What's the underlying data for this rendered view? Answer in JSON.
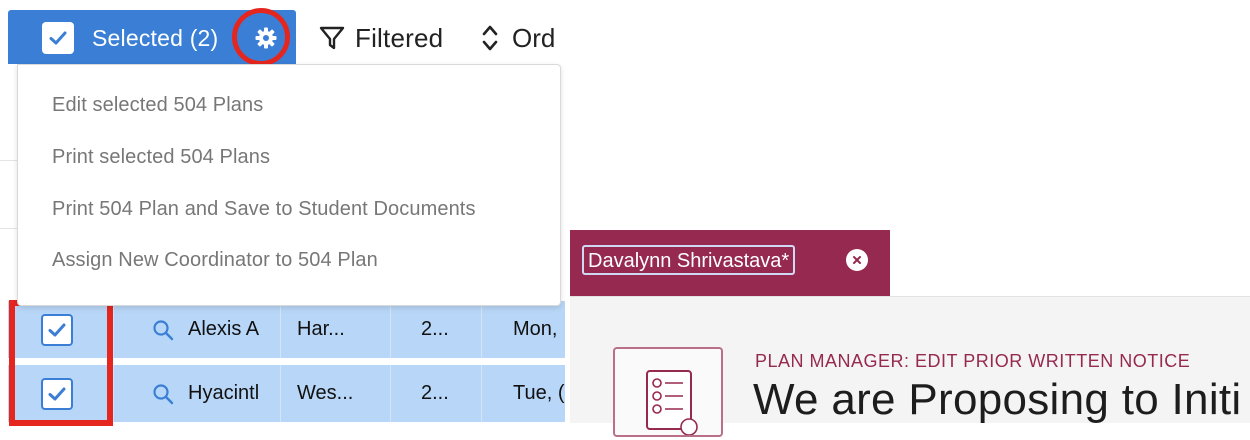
{
  "toolbar": {
    "selected_label": "Selected (2)",
    "filter_label": "Filtered",
    "order_label": "Ord"
  },
  "dropdown": {
    "items": [
      "Edit selected 504 Plans",
      "Print selected 504 Plans",
      "Print 504 Plan and Save to Student Documents",
      "Assign New Coordinator to 504 Plan"
    ]
  },
  "rows": [
    {
      "checked": true,
      "name": "Alexis A",
      "col2": "Har...",
      "col3": "2...",
      "col4": "Mon,"
    },
    {
      "checked": true,
      "name": "Hyacintl",
      "col2": "Wes...",
      "col3": "2...",
      "col4": "Tue, ("
    }
  ],
  "plan_panel": {
    "student_name": "Davalynn Shrivastava*",
    "section_label": "PLAN MANAGER: EDIT PRIOR WRITTEN NOTICE",
    "heading": "We are Proposing to Initi"
  },
  "colors": {
    "primary_blue": "#3a7fd5",
    "row_highlight": "#b8d6f7",
    "maroon": "#96294f",
    "annotation_red": "#e5261f"
  },
  "icons": [
    "check-icon",
    "gear-icon",
    "filter-icon",
    "sort-icon",
    "search-icon",
    "close-icon",
    "document-checklist-icon"
  ]
}
